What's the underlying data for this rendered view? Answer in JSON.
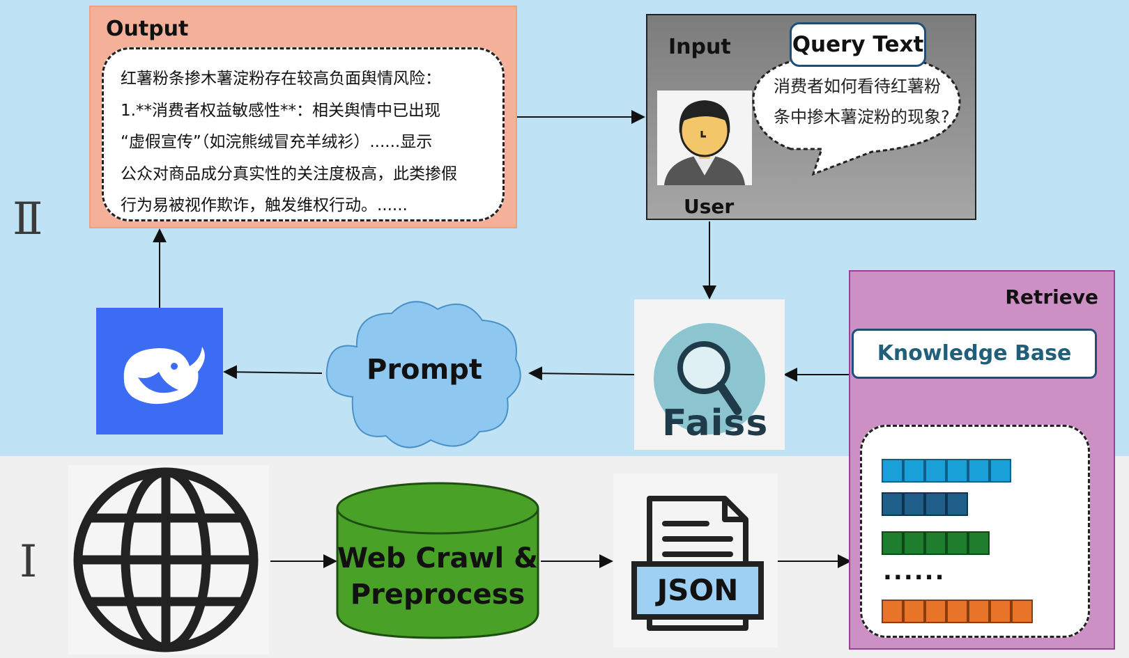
{
  "sections": {
    "stage_two": "Ⅱ",
    "stage_one": "Ⅰ"
  },
  "output": {
    "title": "Output",
    "lines": [
      "红薯粉条掺木薯淀粉存在较高负面舆情风险：",
      "1.**消费者权益敏感性**：相关舆情中已出现",
      "“虚假宣传”（如浣熊绒冒充羊绒衫）......显示",
      "公众对商品成分真实性的关注度极高，此类掺假",
      "行为易被视作欺诈，触发维权行动。......"
    ]
  },
  "input": {
    "title": "Input",
    "user_label": "User",
    "query_label": "Query Text",
    "query_lines": [
      "消费者如何看待红薯粉",
      "条中掺木薯淀粉的现象?"
    ]
  },
  "pipeline": {
    "prompt": "Prompt",
    "faiss": "Faiss",
    "retrieve": "Retrieve",
    "knowledge_base": "Knowledge Base",
    "crawl_line1": "Web Crawl &",
    "crawl_line2": "Preprocess",
    "json": "JSON",
    "vector_ellipsis": "......"
  },
  "icons": {
    "llm": "whale-logo-icon",
    "user": "user-avatar-icon",
    "search": "magnifier-icon",
    "web": "globe-icon",
    "file": "json-file-icon",
    "database": "database-cylinder-icon"
  },
  "colors": {
    "top_band": "#bfe3f4",
    "bottom_band": "#f0f0f0",
    "output_fill": "#f5b09a",
    "input_fill": "#8c8c8c",
    "retrieve_fill": "#cc90c4",
    "llm_blue": "#3c6cf4",
    "cloud_blue": "#8ec8f0",
    "cylinder_green": "#4aa128",
    "vec_cyan": "#1aa0d8",
    "vec_navy": "#1f5f8a",
    "vec_green": "#1e7e2e",
    "vec_orange": "#e8742a"
  }
}
